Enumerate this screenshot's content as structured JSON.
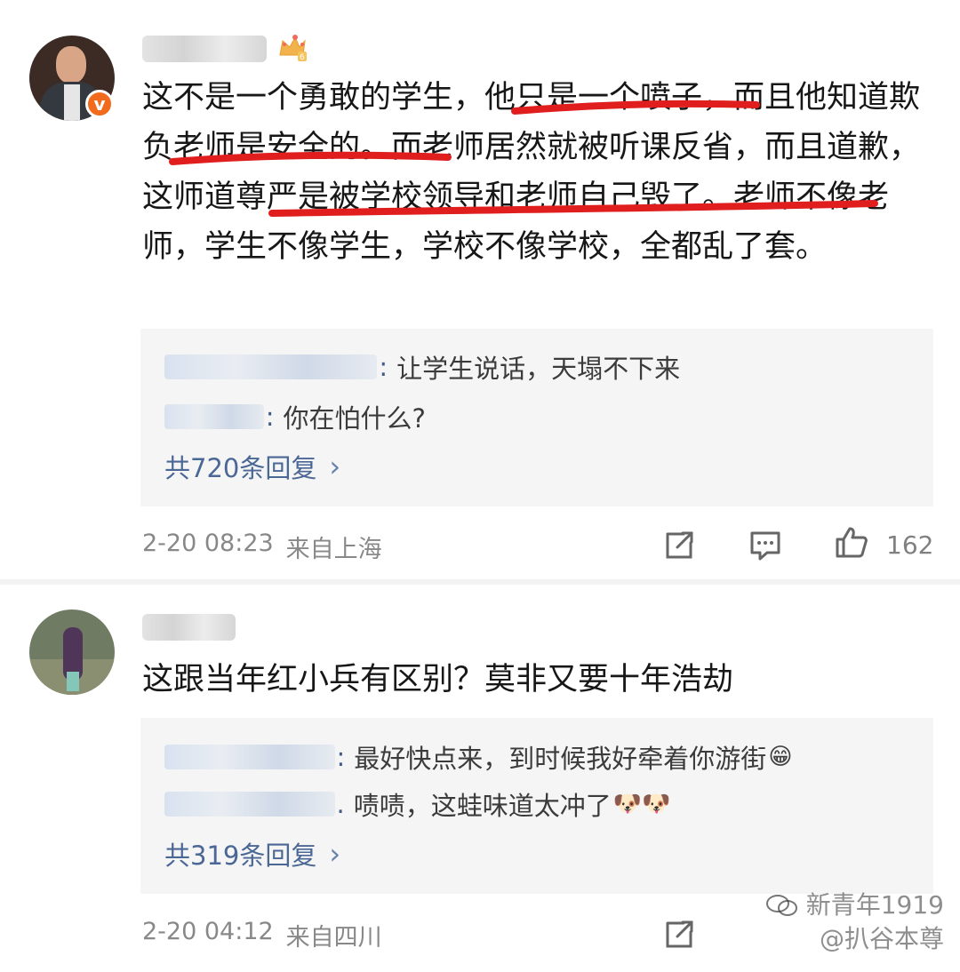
{
  "comments": [
    {
      "username": "▮▮▮▮▮▮▮▮▮",
      "text": "这不是一个勇敢的学生，他只是一个喷子，而且他知道欺负老师是安全的。而老师居然就被听课反省，而且道歉，这师道尊严是被学校领导和老师自己毁了。老师不像老师，学生不像学生，学校不像学校，全都乱了套。",
      "replies": [
        {
          "user": "▮▮▮▮▮▮▮▮▮▮▮▮▮▮▮",
          "text": "让学生说话，天塌不下来"
        },
        {
          "user": "▮▮▮▮▮▮▮",
          "text": "你在怕什么?"
        }
      ],
      "replies_link": "共720条回复",
      "time": "2-20 08:23",
      "location": "来自上海",
      "likes": "162"
    },
    {
      "username": "▮▮▮▮▮▮",
      "text": "这跟当年红小兵有区别？莫非又要十年浩劫",
      "replies": [
        {
          "user": "▮▮▮▮▮▮▮▮▮▮▮▮",
          "text": "最好快点来，到时候我好牵着你游街",
          "emoji": "😁"
        },
        {
          "user": "▮▮▮▮▮▮▮▮▮▮▮▮",
          "text": "啧啧，这蛙味道太冲了",
          "emoji": "🐶🐶"
        }
      ],
      "replies_link": "共319条回复",
      "time": "2-20 04:12",
      "location": "来自四川"
    }
  ],
  "watermark": {
    "line1": "新青年1919",
    "line2": "@扒谷本尊"
  },
  "colors": {
    "link_blue": "#4a6795",
    "meta_gray": "#888888",
    "underline_red": "#e01e1e",
    "verified_orange": "#f26b1d"
  }
}
